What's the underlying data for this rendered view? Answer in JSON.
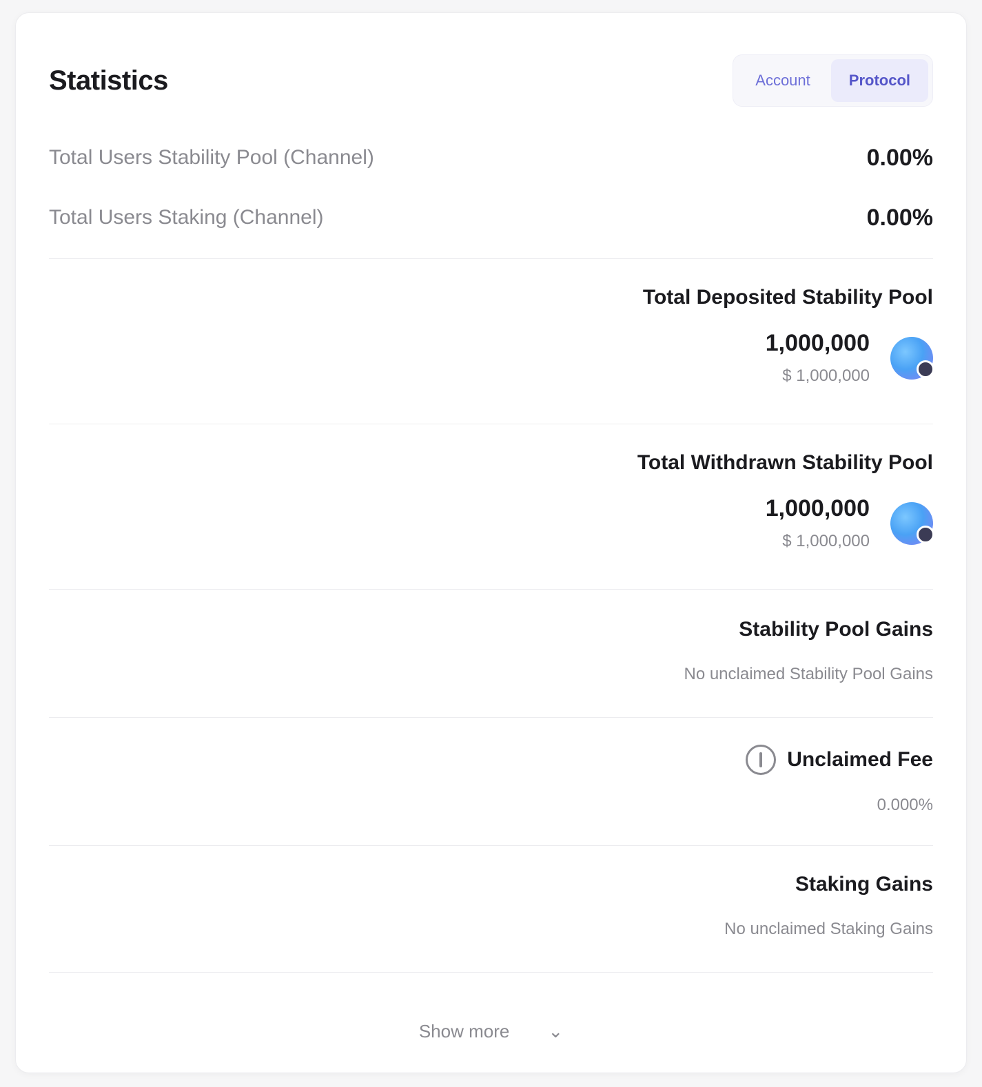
{
  "header": {
    "title": "Statistics",
    "toggle": [
      "Account",
      "Protocol"
    ]
  },
  "stats": [
    {
      "label": "Total Users Stability Pool (Channel)",
      "value": "0.00%"
    },
    {
      "label": "Total Users Staking (Channel)",
      "value": "0.00%"
    }
  ],
  "deposited": {
    "heading": "Total Deposited Stability Pool",
    "amount": "1,000,000",
    "usd": "$ 1,000,000"
  },
  "withdrawn": {
    "heading": "Total Withdrawn Stability Pool",
    "amount": "1,000,000",
    "usd": "$ 1,000,000"
  },
  "sp_gains": {
    "heading": "Stability Pool Gains",
    "sub": "No unclaimed Stability Pool Gains"
  },
  "unclaimed": {
    "heading": "Unclaimed Fee",
    "value": "0.000%"
  },
  "staking": {
    "heading": "Staking Gains",
    "sub": "No unclaimed Staking Gains"
  },
  "footer": {
    "link": "Show more",
    "chevron": "⌄"
  },
  "icons": {
    "token": "token-icon",
    "claim": "info-icon"
  }
}
